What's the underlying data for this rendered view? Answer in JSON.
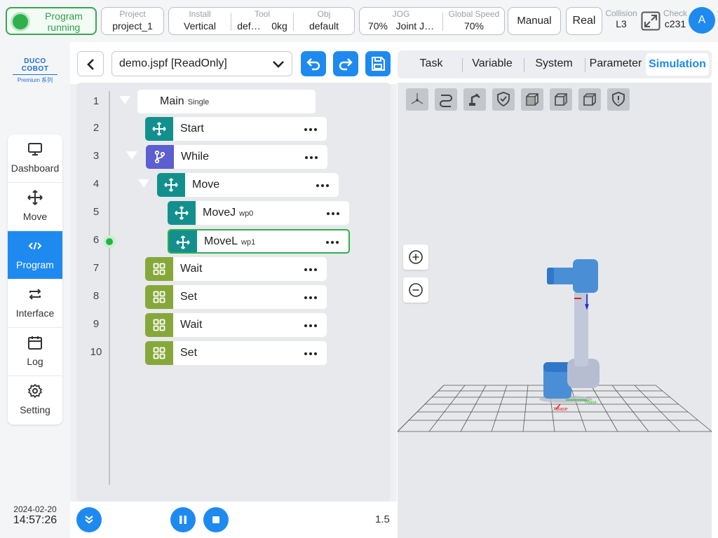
{
  "status": {
    "label": "Program running"
  },
  "header": {
    "project": {
      "label": "Project",
      "value": "project_1"
    },
    "install": {
      "label": "Install",
      "value": "Vertical"
    },
    "tool": {
      "label": "Tool",
      "value": "def…",
      "weight": "0kg"
    },
    "obj": {
      "label": "Obj",
      "value": "default"
    },
    "jog": {
      "label": "JOG",
      "value": "70%",
      "mode": "Joint J…"
    },
    "global_speed": {
      "label": "Global Speed",
      "value": "70%"
    },
    "mode_button": "Manual",
    "real_button": "Real",
    "collision": {
      "label": "Collision",
      "value": "L3"
    },
    "check": {
      "label": "Check",
      "value": "c231"
    },
    "avatar": "A"
  },
  "sidebar": {
    "logo_title": "DUCO COBOT",
    "logo_sub": "Premium 系列",
    "items": [
      {
        "label": "Dashboard",
        "icon": "monitor-icon"
      },
      {
        "label": "Move",
        "icon": "move-arrows-icon"
      },
      {
        "label": "Program",
        "icon": "code-icon",
        "active": true
      },
      {
        "label": "Interface",
        "icon": "swap-icon"
      },
      {
        "label": "Log",
        "icon": "calendar-icon"
      },
      {
        "label": "Setting",
        "icon": "gear-icon"
      }
    ],
    "date": "2024-02-20",
    "time": "14:57:26"
  },
  "editor": {
    "file_name": "demo.jspf [ReadOnly]",
    "line_numbers": [
      "1",
      "2",
      "3",
      "4",
      "5",
      "6",
      "7",
      "8",
      "9",
      "10"
    ],
    "nodes": [
      {
        "name": "Main",
        "sub": "Single"
      },
      {
        "name": "Start",
        "sub": ""
      },
      {
        "name": "While",
        "sub": ""
      },
      {
        "name": "Move",
        "sub": ""
      },
      {
        "name": "MoveJ",
        "sub": "wp0"
      },
      {
        "name": "MoveL",
        "sub": "wp1"
      },
      {
        "name": "Wait",
        "sub": ""
      },
      {
        "name": "Set",
        "sub": ""
      },
      {
        "name": "Wait",
        "sub": ""
      },
      {
        "name": "Set",
        "sub": ""
      }
    ],
    "current_line": 6,
    "speed": "1.5"
  },
  "tabs": [
    "Task",
    "Variable",
    "System",
    "Parameter",
    "Simulation"
  ],
  "active_tab": "Simulation",
  "simulation": {
    "toolbar": [
      "axes-view-icon",
      "path-icon",
      "robot-icon",
      "shield-check-icon",
      "cube-front-icon",
      "cube-side-icon",
      "cube-top-icon",
      "shield-info-icon"
    ],
    "zoom_in": "zoom-in-icon",
    "zoom_out": "zoom-out-icon"
  },
  "colors": {
    "accent": "#1e8af0",
    "running": "#2fb04d",
    "teal": "#13908e",
    "purple": "#5b5fcf",
    "olive": "#86a83a"
  }
}
